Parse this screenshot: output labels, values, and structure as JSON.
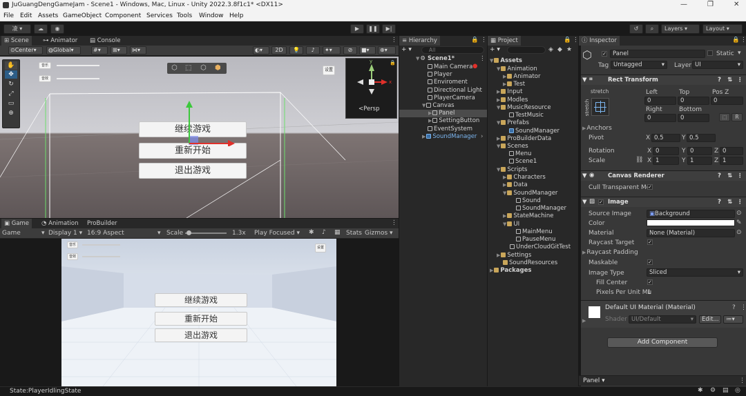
{
  "window": {
    "title": "JuGuangDengGameJam - Scene1 - Windows, Mac, Linux - Unity 2022.3.8f1c1* <DX11>"
  },
  "menu": [
    "File",
    "Edit",
    "Assets",
    "GameObject",
    "Component",
    "Services",
    "Tools",
    "Window",
    "Help"
  ],
  "toolbar": {
    "account": "凌",
    "layers": "Layers",
    "layout": "Layout"
  },
  "scene_tabs": {
    "scene": "Scene",
    "animator": "Animator",
    "console": "Console"
  },
  "scene_strip": {
    "pivot": "Center",
    "space": "Global",
    "mode2d": "2D"
  },
  "scene_view": {
    "btn_music": "音乐",
    "btn_sfx": "音效",
    "btn_settings": "设置",
    "menu": [
      "继续游戏",
      "重新开始",
      "退出游戏"
    ],
    "gizmo_label": "<Persp",
    "axis_y": "y",
    "axis_x": "x"
  },
  "game_tabs": {
    "game": "Game",
    "animation": "Animation",
    "probuilder": "ProBuilder"
  },
  "game_strip": {
    "view": "Game",
    "display": "Display 1",
    "aspect": "16:9 Aspect",
    "scale_label": "Scale",
    "scale_value": "1.3x",
    "play": "Play Focused",
    "stats": "Stats",
    "gizmos": "Gizmos"
  },
  "game_view": {
    "btn_music": "音乐",
    "btn_sfx": "音效",
    "btn_settings": "设置",
    "menu": [
      "继续游戏",
      "重新开始",
      "退出游戏"
    ]
  },
  "hierarchy": {
    "title": "Hierarchy",
    "search": "All",
    "items": [
      "Scene1*",
      "Main Camera",
      "Player",
      "Enviroment",
      "Directional Light",
      "PlayerCamera",
      "Canvas",
      "Panel",
      "SettingButton",
      "EventSystem",
      "SoundManager"
    ]
  },
  "project": {
    "title": "Project",
    "items": [
      "Assets",
      "Animation",
      "Animator",
      "Test",
      "Input",
      "Modles",
      "MusicResource",
      "TestMusic",
      "Prefabs",
      "SoundManager",
      "ProBuilderData",
      "Scenes",
      "Menu",
      "Scene1",
      "Scripts",
      "Characters",
      "Data",
      "SoundManager",
      "Sound",
      "SoundManager",
      "StateMachine",
      "UI",
      "MainMenu",
      "PauseMenu",
      "UnderCloudGitTest",
      "Settings",
      "SoundResources",
      "Packages"
    ]
  },
  "inspector": {
    "title": "Inspector",
    "object_name": "Panel",
    "static_label": "Static",
    "tag_label": "Tag",
    "tag": "Untagged",
    "layer_label": "Layer",
    "layer": "UI",
    "rect": {
      "title": "Rect Transform",
      "stretch": "stretch",
      "stretch_v": "stretch",
      "left": "Left",
      "top": "Top",
      "posz": "Pos Z",
      "left_v": "0",
      "top_v": "0",
      "posz_v": "0",
      "right": "Right",
      "bottom": "Bottom",
      "right_v": "0",
      "bottom_v": "0",
      "r_btn": "R",
      "anchors": "Anchors",
      "pivot": "Pivot",
      "pivot_x": "0.5",
      "pivot_y": "0.5",
      "rotation": "Rotation",
      "rot_x": "0",
      "rot_y": "0",
      "rot_z": "0",
      "scale": "Scale",
      "scale_x": "1",
      "scale_y": "1",
      "scale_z": "1",
      "x": "X",
      "y": "Y",
      "z": "Z"
    },
    "canvas_renderer": {
      "title": "Canvas Renderer",
      "cull": "Cull Transparent Me"
    },
    "image": {
      "title": "Image",
      "source_label": "Source Image",
      "source": "Background",
      "color_label": "Color",
      "material_label": "Material",
      "material": "None (Material)",
      "raycast_target": "Raycast Target",
      "raycast_padding": "Raycast Padding",
      "maskable": "Maskable",
      "type_label": "Image Type",
      "type": "Sliced",
      "fill_center": "Fill Center",
      "ppu_label": "Pixels Per Unit Mu",
      "ppu": "1"
    },
    "material": {
      "title": "Default UI Material (Material)",
      "shader_label": "Shader",
      "shader": "UI/Default",
      "edit": "Edit..."
    },
    "add_component": "Add Component",
    "footer": "Panel"
  },
  "status": {
    "text": "State:PlayerIdlingState"
  },
  "colors": {
    "accent": "#2c5d87",
    "selection": "#2c5d87",
    "gizmo_red": "#e0302a",
    "gizmo_green": "#3cc83c"
  }
}
